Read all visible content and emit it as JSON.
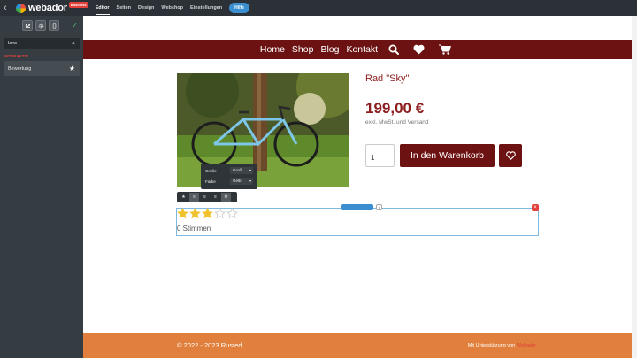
{
  "topbar": {
    "back_icon": "chevron-left-icon",
    "brand": "webador",
    "badge": "Business",
    "tabs": [
      {
        "label": "Editor",
        "active": true
      },
      {
        "label": "Seiten",
        "active": false
      },
      {
        "label": "Design",
        "active": false
      },
      {
        "label": "Webshop",
        "active": false
      },
      {
        "label": "Einstellungen",
        "active": false
      }
    ],
    "help_label": "Hilfe"
  },
  "sidebar": {
    "tools": [
      "external-link-icon",
      "gear-icon",
      "mobile-icon"
    ],
    "search_value": "bew",
    "clear_glyph": "×",
    "category": "INTERAKTIV",
    "items": [
      {
        "label": "Bewertung",
        "icon": "star-icon"
      }
    ]
  },
  "site": {
    "nav_links": [
      "Home",
      "Shop",
      "Blog",
      "Kontakt"
    ],
    "nav_icons": [
      "search-icon",
      "heart-icon",
      "cart-icon"
    ],
    "product_title": "Rad \"Sky\"",
    "price": "199,00 €",
    "vat_note": "exkl. MwSt. und Versand",
    "quantity": "1",
    "cart_button": "In den Warenkorb",
    "variant": {
      "size_label": "Größe",
      "size_value": "Groß",
      "color_label": "Farbe",
      "color_value": "Gelb"
    },
    "rating": {
      "value": 3,
      "max": 5,
      "votes_text": "0 Stimmen"
    },
    "handle_icon": "i",
    "delete_glyph": "×"
  },
  "footer": {
    "copyright": "© 2022 - 2023 Rusted",
    "made_with": "Mit Unterstützung von",
    "made_brand": "Webador"
  },
  "colors": {
    "accent": "#6c1212",
    "footer": "#e0803c",
    "star": "#f2c12e"
  }
}
